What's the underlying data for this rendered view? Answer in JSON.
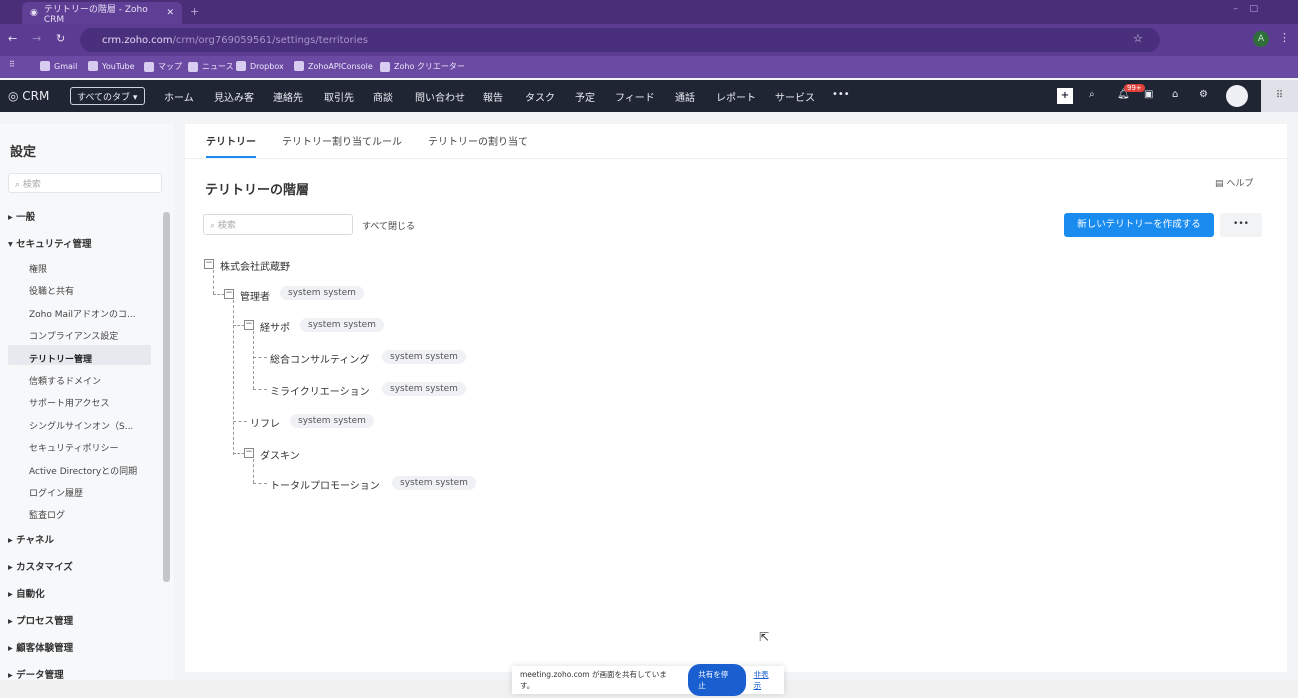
{
  "browser": {
    "tab_title": "テリトリーの階層 - Zoho CRM",
    "url_host": "crm.zoho.com",
    "url_path": "/crm/org769059561/settings/territories",
    "bookmarks": [
      "Gmail",
      "YouTube",
      "マップ",
      "ニュース",
      "Dropbox",
      "ZohoAPIConsole",
      "Zoho クリエーター"
    ],
    "profile": "A"
  },
  "crm": {
    "logo": "CRM",
    "all_tabs": "すべてのタブ ▾",
    "nav": [
      "ホーム",
      "見込み客",
      "連絡先",
      "取引先",
      "商談",
      "問い合わせ",
      "報告",
      "タスク",
      "予定",
      "フィード",
      "通話",
      "レポート",
      "サービス",
      "•••"
    ],
    "notif_badge": "99+"
  },
  "sidebar": {
    "title": "設定",
    "search_placeholder": "検索",
    "groups_top": [
      {
        "label": "一般"
      },
      {
        "label": "セキュリティ管理"
      }
    ],
    "items": [
      "権限",
      "役職と共有",
      "Zoho Mailアドオンのコ...",
      "コンプライアンス設定",
      "テリトリー管理",
      "信頼するドメイン",
      "サポート用アクセス",
      "シングルサインオン（S...",
      "セキュリティポリシー",
      "Active Directoryとの同期",
      "ログイン履歴",
      "監査ログ"
    ],
    "active_item": "テリトリー管理",
    "groups_bottom": [
      "チャネル",
      "カスタマイズ",
      "自動化",
      "プロセス管理",
      "顧客体験管理",
      "データ管理"
    ]
  },
  "main": {
    "tabs": [
      "テリトリー",
      "テリトリー割り当てルール",
      "テリトリーの割り当て"
    ],
    "title": "テリトリーの階層",
    "help": "ヘルプ",
    "search_placeholder": "検索",
    "collapse_all": "すべて閉じる",
    "create_button": "新しいテリトリーを作成する",
    "more": "•••",
    "tree": [
      {
        "label": "株式会社武蔵野",
        "owner": null
      },
      {
        "label": "管理者",
        "owner": "system system"
      },
      {
        "label": "経サポ",
        "owner": "system system"
      },
      {
        "label": "総合コンサルティング",
        "owner": "system system"
      },
      {
        "label": "ミライクリエーション",
        "owner": "system system"
      },
      {
        "label": "リフレ",
        "owner": "system system"
      },
      {
        "label": "ダスキン",
        "owner": null
      },
      {
        "label": "トータルプロモーション",
        "owner": "system system"
      }
    ]
  },
  "share_bar": {
    "text": "meeting.zoho.com が画面を共有しています。",
    "stop": "共有を停止",
    "hide": "非表示"
  }
}
